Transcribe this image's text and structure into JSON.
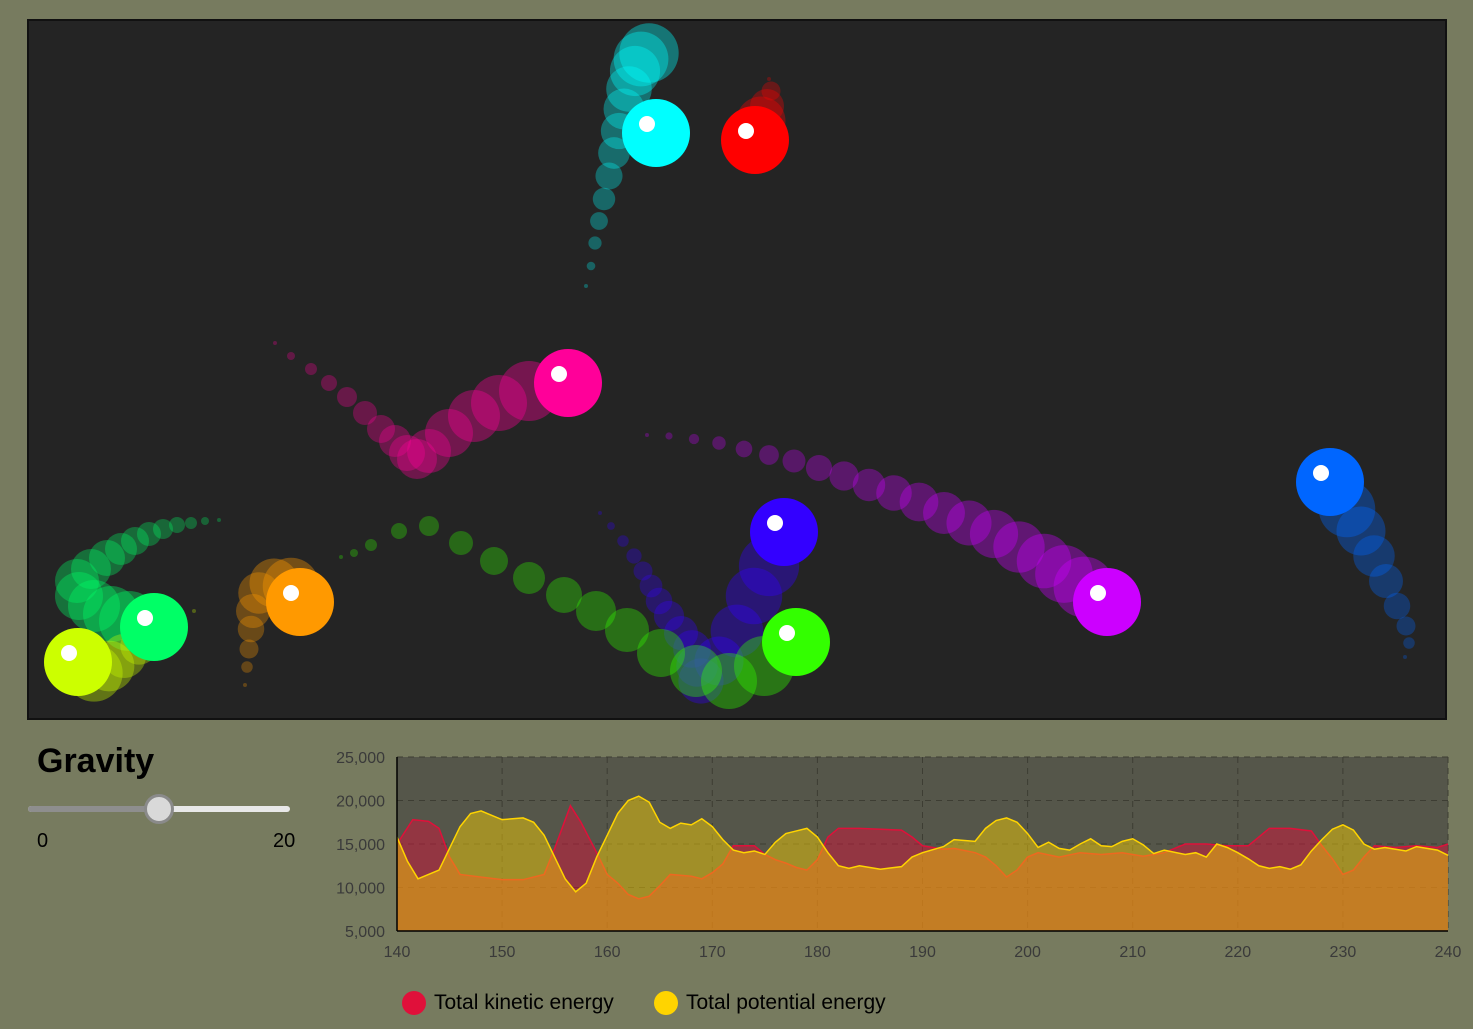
{
  "simulation": {
    "balls": [
      {
        "name": "cyan",
        "color": "#00ffff"
      },
      {
        "name": "red",
        "color": "#ff0000"
      },
      {
        "name": "pink",
        "color": "#ff0099"
      },
      {
        "name": "blue",
        "color": "#0066ff"
      },
      {
        "name": "indigo",
        "color": "#3300ff"
      },
      {
        "name": "purple",
        "color": "#cc00ff"
      },
      {
        "name": "green",
        "color": "#33ff00"
      },
      {
        "name": "orange",
        "color": "#ff9900"
      },
      {
        "name": "spring-green",
        "color": "#00ff66"
      },
      {
        "name": "lime",
        "color": "#ccff00"
      }
    ]
  },
  "gravity": {
    "title": "Gravity",
    "min_label": "0",
    "max_label": "20",
    "min": 0,
    "max": 20,
    "value": 10
  },
  "chart_data": {
    "type": "area",
    "xlim": [
      140,
      240
    ],
    "ylim": [
      5000,
      25000
    ],
    "x_ticks": [
      "140",
      "150",
      "160",
      "170",
      "180",
      "190",
      "200",
      "210",
      "220",
      "230",
      "240"
    ],
    "y_ticks": [
      "25,000",
      "20,000",
      "15,000",
      "10,000",
      "5,000"
    ],
    "grid": true,
    "legend_position": "bottom",
    "series": [
      {
        "name": "Total kinetic energy",
        "color": "#e0103a",
        "points": [
          [
            140,
            15000
          ],
          [
            141.5,
            17800
          ],
          [
            143,
            17600
          ],
          [
            144,
            16800
          ],
          [
            145,
            13500
          ],
          [
            146,
            11500
          ],
          [
            148,
            11200
          ],
          [
            150,
            10900
          ],
          [
            152,
            10900
          ],
          [
            154,
            11500
          ],
          [
            155,
            14500
          ],
          [
            156.5,
            19400
          ],
          [
            157.5,
            17500
          ],
          [
            159,
            14000
          ],
          [
            160,
            11500
          ],
          [
            161,
            10500
          ],
          [
            162,
            9200
          ],
          [
            163,
            8700
          ],
          [
            164,
            9000
          ],
          [
            165,
            10200
          ],
          [
            166,
            11500
          ],
          [
            168,
            11300
          ],
          [
            169,
            11000
          ],
          [
            170,
            11700
          ],
          [
            171,
            12700
          ],
          [
            172,
            14800
          ],
          [
            174,
            14800
          ],
          [
            175,
            13800
          ],
          [
            176,
            13200
          ],
          [
            177,
            12800
          ],
          [
            178,
            12300
          ],
          [
            179,
            12000
          ],
          [
            180,
            13200
          ],
          [
            181,
            15800
          ],
          [
            182,
            16800
          ],
          [
            184,
            16800
          ],
          [
            186,
            16700
          ],
          [
            188,
            16600
          ],
          [
            189,
            15800
          ],
          [
            190,
            14800
          ],
          [
            192,
            14400
          ],
          [
            193,
            14500
          ],
          [
            195,
            14000
          ],
          [
            196,
            13500
          ],
          [
            197,
            12500
          ],
          [
            198,
            11200
          ],
          [
            199,
            12000
          ],
          [
            200,
            13500
          ],
          [
            201,
            14000
          ],
          [
            203,
            13500
          ],
          [
            205,
            14000
          ],
          [
            207,
            13800
          ],
          [
            209,
            14000
          ],
          [
            211,
            13600
          ],
          [
            213,
            14000
          ],
          [
            215,
            15000
          ],
          [
            217,
            15000
          ],
          [
            219,
            14800
          ],
          [
            221,
            14800
          ],
          [
            222,
            15800
          ],
          [
            223,
            16800
          ],
          [
            225,
            16800
          ],
          [
            227,
            16500
          ],
          [
            228,
            14800
          ],
          [
            229,
            13300
          ],
          [
            230,
            11500
          ],
          [
            231,
            12000
          ],
          [
            232,
            13500
          ],
          [
            233,
            14800
          ],
          [
            235,
            14600
          ],
          [
            237,
            14800
          ],
          [
            239,
            14600
          ],
          [
            240,
            15000
          ]
        ]
      },
      {
        "name": "Total potential energy",
        "color": "#ffd400",
        "points": [
          [
            140,
            15800
          ],
          [
            141,
            13000
          ],
          [
            142,
            11000
          ],
          [
            143,
            11500
          ],
          [
            144,
            12000
          ],
          [
            145,
            14500
          ],
          [
            146,
            17000
          ],
          [
            147,
            18500
          ],
          [
            148,
            18800
          ],
          [
            149,
            18300
          ],
          [
            150,
            17800
          ],
          [
            152,
            18000
          ],
          [
            153,
            17500
          ],
          [
            154,
            16000
          ],
          [
            155,
            13500
          ],
          [
            156,
            11000
          ],
          [
            157,
            9500
          ],
          [
            158,
            10500
          ],
          [
            159,
            13500
          ],
          [
            160,
            16000
          ],
          [
            161,
            18500
          ],
          [
            162,
            20000
          ],
          [
            163,
            20500
          ],
          [
            164,
            19800
          ],
          [
            165,
            17500
          ],
          [
            166,
            16800
          ],
          [
            167,
            17400
          ],
          [
            168,
            17200
          ],
          [
            169,
            17900
          ],
          [
            170,
            17000
          ],
          [
            171,
            15500
          ],
          [
            172,
            14300
          ],
          [
            173,
            14000
          ],
          [
            174,
            14200
          ],
          [
            175,
            13800
          ],
          [
            176,
            15200
          ],
          [
            177,
            16200
          ],
          [
            178,
            16500
          ],
          [
            179,
            16800
          ],
          [
            180,
            15800
          ],
          [
            181,
            14000
          ],
          [
            182,
            12500
          ],
          [
            183,
            12200
          ],
          [
            184,
            12500
          ],
          [
            186,
            12100
          ],
          [
            188,
            12400
          ],
          [
            189,
            13500
          ],
          [
            190,
            14000
          ],
          [
            192,
            14700
          ],
          [
            193,
            15500
          ],
          [
            195,
            15300
          ],
          [
            196,
            16800
          ],
          [
            197,
            17700
          ],
          [
            198,
            18000
          ],
          [
            199,
            17500
          ],
          [
            200,
            16200
          ],
          [
            201,
            14600
          ],
          [
            202,
            15200
          ],
          [
            203,
            14500
          ],
          [
            204,
            14300
          ],
          [
            205,
            15000
          ],
          [
            206,
            15600
          ],
          [
            207,
            14800
          ],
          [
            208,
            14700
          ],
          [
            209,
            15300
          ],
          [
            210,
            15600
          ],
          [
            211,
            14900
          ],
          [
            212,
            13900
          ],
          [
            213,
            14300
          ],
          [
            215,
            13800
          ],
          [
            216,
            14000
          ],
          [
            217,
            13500
          ],
          [
            218,
            15000
          ],
          [
            219,
            14600
          ],
          [
            220,
            14000
          ],
          [
            221,
            13300
          ],
          [
            222,
            12500
          ],
          [
            223,
            12200
          ],
          [
            224,
            12400
          ],
          [
            225,
            12100
          ],
          [
            226,
            12600
          ],
          [
            227,
            14200
          ],
          [
            228,
            15500
          ],
          [
            229,
            16700
          ],
          [
            230,
            17200
          ],
          [
            231,
            16600
          ],
          [
            232,
            15000
          ],
          [
            233,
            14400
          ],
          [
            234,
            14600
          ],
          [
            235,
            14400
          ],
          [
            236,
            14200
          ],
          [
            237,
            14700
          ],
          [
            238,
            14500
          ],
          [
            239,
            14300
          ],
          [
            240,
            13700
          ]
        ]
      }
    ]
  }
}
